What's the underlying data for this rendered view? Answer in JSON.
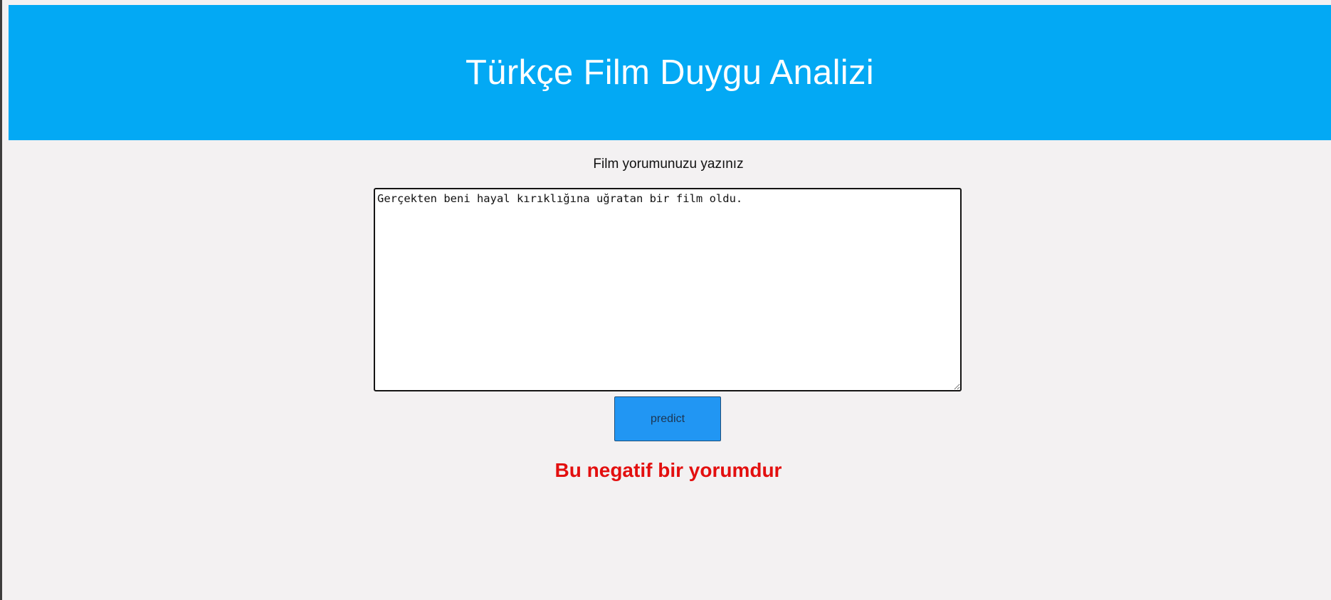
{
  "header": {
    "title": "Türkçe Film Duygu Analizi"
  },
  "form": {
    "prompt_label": "Film yorumunuzu yazınız",
    "review_value": "Gerçekten beni hayal kırıklığına uğratan bir film oldu.",
    "predict_label": "predict"
  },
  "result": {
    "message": "Bu negatif bir yorumdur"
  },
  "colors": {
    "header_background": "#03a9f4",
    "page_background": "#f3f1f2",
    "button_background": "#2196f3",
    "result_text": "#e30f0f"
  }
}
